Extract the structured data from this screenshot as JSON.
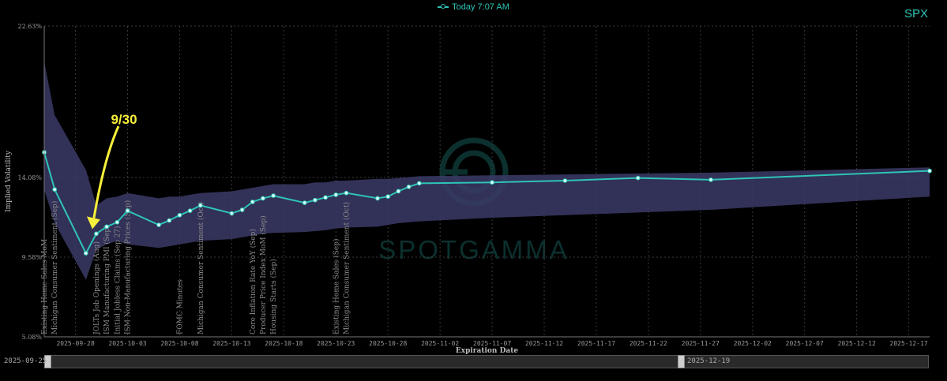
{
  "ticker": "SPX",
  "legend_label": "Today 7:07 AM",
  "annotation_label": "9/30",
  "colors": {
    "line": "#2ec4b6",
    "band": "#3b3a66",
    "arrow": "#f7f03a",
    "grid": "#3a3a3a",
    "text": "#9a9a9a"
  },
  "range_slider": {
    "start_label": "2025-09-25",
    "end_label": "2025-12-19"
  },
  "chart_data": {
    "type": "line",
    "title": "",
    "xlabel": "Expiration Date",
    "ylabel": "Implied Volatility",
    "x_range": [
      "2025-09-25",
      "2025-12-19"
    ],
    "ylim": [
      5.08,
      22.63
    ],
    "y_ticks": [
      "5.08%",
      "9.58%",
      "14.08%",
      "22.63%"
    ],
    "x_ticks": [
      "2025-09-28",
      "2025-10-03",
      "2025-10-08",
      "2025-10-13",
      "2025-10-18",
      "2025-10-23",
      "2025-10-28",
      "2025-11-02",
      "2025-11-07",
      "2025-11-12",
      "2025-11-17",
      "2025-11-22",
      "2025-11-27",
      "2025-12-02",
      "2025-12-07",
      "2025-12-12",
      "2025-12-17"
    ],
    "grid": true,
    "series": [
      {
        "name": "Today 7:07 AM",
        "x": [
          "2025-09-25",
          "2025-09-26",
          "2025-09-29",
          "2025-09-30",
          "2025-10-01",
          "2025-10-02",
          "2025-10-03",
          "2025-10-06",
          "2025-10-07",
          "2025-10-08",
          "2025-10-09",
          "2025-10-10",
          "2025-10-13",
          "2025-10-14",
          "2025-10-15",
          "2025-10-16",
          "2025-10-17",
          "2025-10-20",
          "2025-10-21",
          "2025-10-22",
          "2025-10-23",
          "2025-10-24",
          "2025-10-27",
          "2025-10-28",
          "2025-10-29",
          "2025-10-30",
          "2025-10-31",
          "2025-11-07",
          "2025-11-14",
          "2025-11-21",
          "2025-11-28",
          "2025-12-19"
        ],
        "values": [
          15.5,
          13.4,
          9.8,
          10.9,
          11.3,
          11.55,
          12.2,
          11.4,
          11.65,
          11.95,
          12.2,
          12.5,
          12.05,
          12.25,
          12.7,
          12.9,
          13.05,
          12.65,
          12.8,
          12.95,
          13.1,
          13.2,
          12.9,
          13.0,
          13.3,
          13.55,
          13.75,
          13.8,
          13.9,
          14.05,
          13.95,
          14.45
        ]
      },
      {
        "name": "band upper",
        "values": [
          20.6,
          17.6,
          14.5,
          12.5,
          12.9,
          13.0,
          13.2,
          12.9,
          13.0,
          13.0,
          13.1,
          13.2,
          13.3,
          13.4,
          13.5,
          13.6,
          13.7,
          13.7,
          13.8,
          13.8,
          13.9,
          13.9,
          14.0,
          14.0,
          14.05,
          14.1,
          14.15,
          14.2,
          14.25,
          14.3,
          14.35,
          14.65
        ]
      },
      {
        "name": "band lower",
        "values": [
          13.4,
          11.5,
          8.3,
          10.0,
          10.3,
          10.5,
          10.3,
          10.1,
          10.2,
          10.3,
          10.4,
          10.5,
          10.6,
          10.7,
          10.8,
          10.9,
          10.95,
          11.0,
          11.05,
          11.1,
          11.2,
          11.25,
          11.3,
          11.4,
          11.5,
          11.55,
          11.6,
          11.8,
          11.95,
          12.1,
          12.25,
          13.0
        ]
      }
    ],
    "annotations": [
      {
        "x": "2025-09-25",
        "text": "Existing Home Sales MoM"
      },
      {
        "x": "2025-09-26",
        "text": "Michigan Consumer Sentiment (Sep)"
      },
      {
        "x": "2025-09-30",
        "text": "JOLTs Job Openings (Aug)"
      },
      {
        "x": "2025-10-01",
        "text": "ISM Manufacturing PMI (Sep)"
      },
      {
        "x": "2025-10-02",
        "text": "Initial Jobless Claims (Sep 27)"
      },
      {
        "x": "2025-10-03",
        "text": "ISM Non-Manufacturing Prices (Sep)"
      },
      {
        "x": "2025-10-08",
        "text": "FOMC Minutes"
      },
      {
        "x": "2025-10-10",
        "text": "Michigan Consumer Sentiment (Oct)"
      },
      {
        "x": "2025-10-15",
        "text": "Core Inflation Rate YoY (Sep)"
      },
      {
        "x": "2025-10-16",
        "text": "Producer Price Index MoM (Sep)"
      },
      {
        "x": "2025-10-17",
        "text": "Housing Starts (Sep)"
      },
      {
        "x": "2025-10-23",
        "text": "Existing Home Sales (Sep)"
      },
      {
        "x": "2025-10-24",
        "text": "Michigan Consumer Sentiment (Oct)"
      }
    ]
  }
}
